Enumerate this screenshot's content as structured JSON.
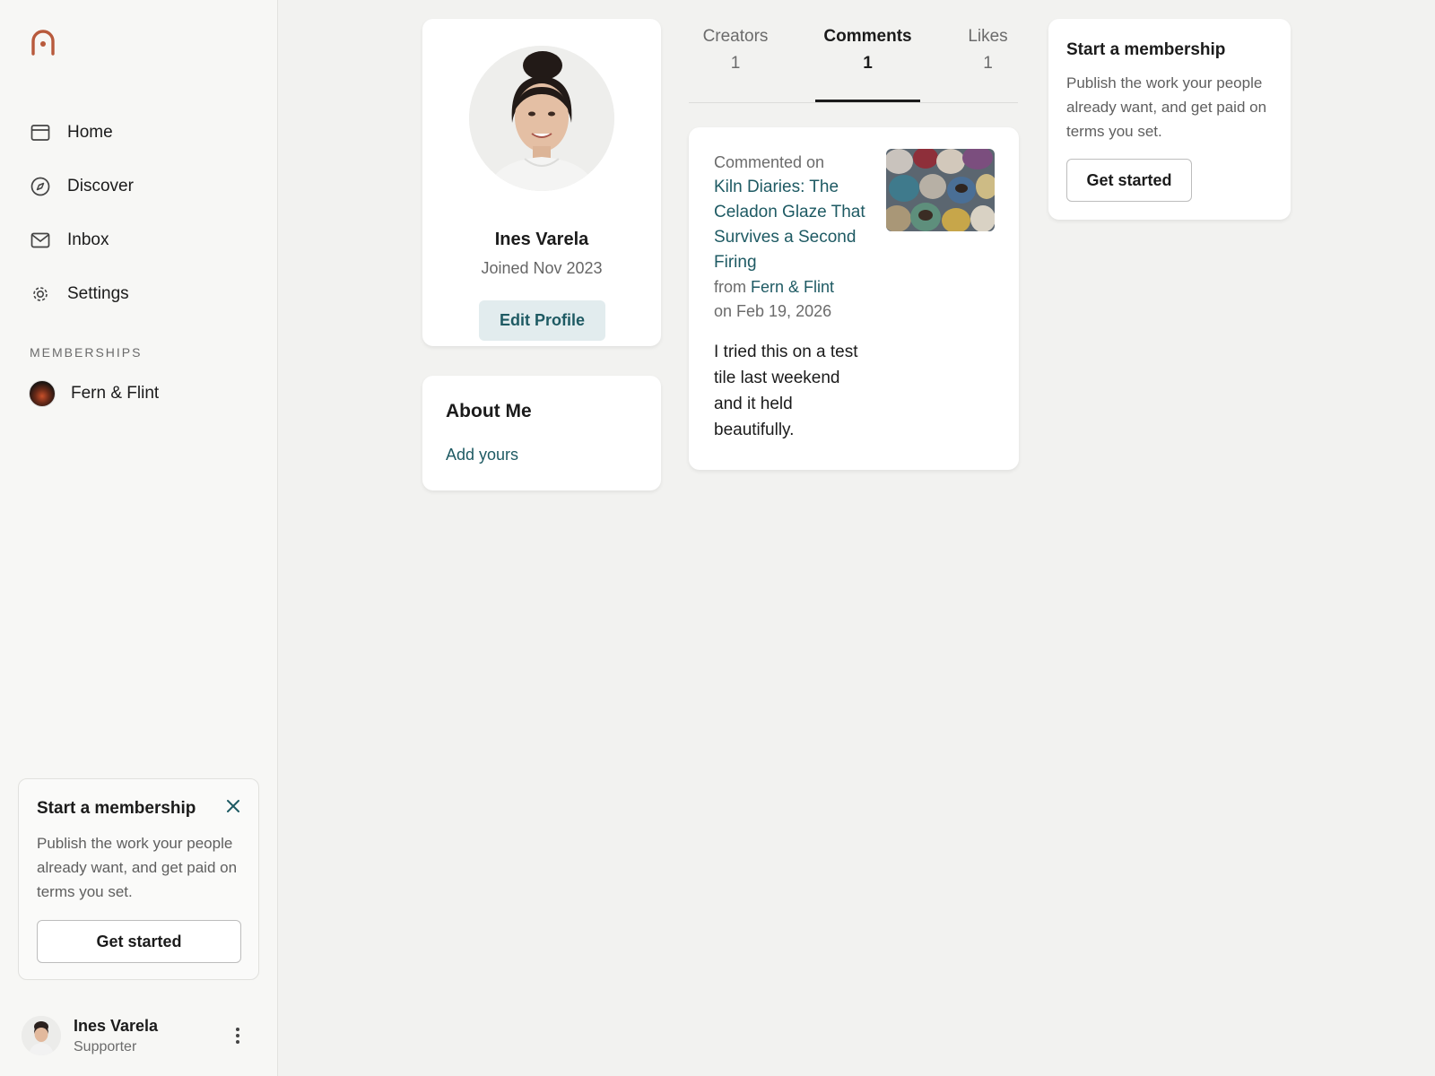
{
  "brand": {
    "logo_icon": "patreon-arch-logo-icon",
    "accent_color": "#b85a3c"
  },
  "sidebar": {
    "nav": [
      {
        "label": "Home",
        "icon": "home-card-icon"
      },
      {
        "label": "Discover",
        "icon": "compass-icon"
      },
      {
        "label": "Inbox",
        "icon": "mail-icon"
      },
      {
        "label": "Settings",
        "icon": "gear-icon"
      }
    ],
    "memberships_heading": "MEMBERSHIPS",
    "memberships": [
      {
        "label": "Fern & Flint"
      }
    ],
    "promo": {
      "title": "Start a membership",
      "body": "Publish the work your people already want, and get paid on terms you set.",
      "button": "Get started"
    },
    "user": {
      "name": "Ines Varela",
      "role": "Supporter"
    }
  },
  "profile": {
    "name": "Ines Varela",
    "joined": "Joined Nov 2023",
    "edit_button": "Edit Profile"
  },
  "about": {
    "title": "About Me",
    "link": "Add yours"
  },
  "tabs": [
    {
      "label": "Creators",
      "count": "1",
      "active": false
    },
    {
      "label": "Comments",
      "count": "1",
      "active": true
    },
    {
      "label": "Likes",
      "count": "1",
      "active": false
    }
  ],
  "comment": {
    "prefix": "Commented on",
    "post_title": "Kiln Diaries: The Celadon Glaze That Survives a Second Firing",
    "from_prefix": "from",
    "creator": "Fern & Flint",
    "date": "on Feb 19, 2026",
    "body": "I tried this on a test tile last weekend and it held beautifully."
  },
  "promo_card": {
    "title": "Start a membership",
    "body": "Publish the work your people already want, and get paid on terms you set.",
    "button": "Get started"
  },
  "colors": {
    "link": "#1e5a63",
    "edit_button_bg": "#e2ecee"
  }
}
